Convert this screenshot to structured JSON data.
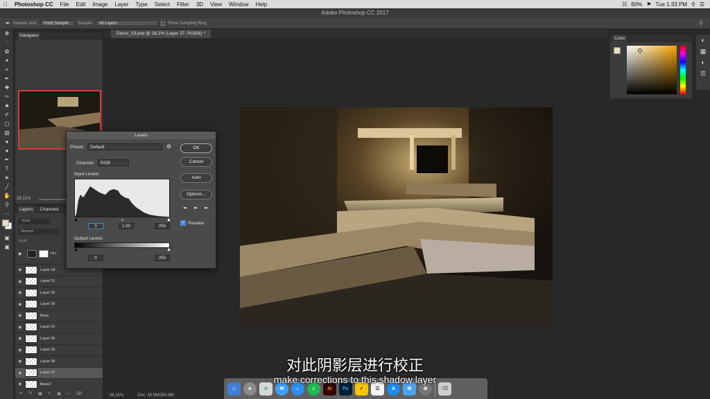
{
  "menubar": {
    "apple": "",
    "items": [
      "Photoshop CC",
      "File",
      "Edit",
      "Image",
      "Layer",
      "Type",
      "Select",
      "Filter",
      "3D",
      "View",
      "Window",
      "Help"
    ],
    "battery": "60%",
    "clock": "Tue 1:33 PM"
  },
  "window": {
    "title": "Adobe Photoshop CC 2017"
  },
  "options": {
    "sample_size_label": "Sample Size:",
    "sample_size_value": "Point Sample",
    "sample_label": "Sample:",
    "sample_value": "All Layers",
    "ring_label": "Show Sampling Ring"
  },
  "document": {
    "tab": "Demo_03.psd @ 28.2% (Layer 37, RGB/8) *"
  },
  "navigator": {
    "title": "Navigator",
    "zoom": "28.21%"
  },
  "layers_panel": {
    "tabs": [
      "Layers",
      "Channels"
    ],
    "kind": "Kind",
    "blend": "Normal",
    "lock_label": "Lock:",
    "rows": [
      "Layer 18",
      "Layer 31",
      "Layer 33",
      "Layer 30",
      "Base",
      "Layer 21",
      "Layer 35",
      "Layer 33",
      "Layer 36",
      "Layer 37",
      "Base2"
    ],
    "selected": "Layer 37",
    "adjustment_label": "Hu..."
  },
  "color_panel": {
    "title": "Color",
    "fg": "#e9dcc0"
  },
  "status": {
    "zoom": "28.21%",
    "doc": "Doc: 16.0M/250.8M"
  },
  "levels": {
    "title": "Levels",
    "preset_label": "Preset:",
    "preset_value": "Default",
    "channel_label": "Channel:",
    "channel_value": "RGB",
    "input_label": "Input Levels:",
    "input_black": "0",
    "input_gamma": "1.00",
    "input_white": "255",
    "output_label": "Output Levels:",
    "output_black": "0",
    "output_white": "255",
    "buttons": {
      "ok": "OK",
      "cancel": "Cancel",
      "auto": "Auto",
      "options": "Options..."
    },
    "preview_label": "Preview",
    "preview_checked": true
  },
  "dock": {
    "items": [
      "finder",
      "launchpad",
      "photos",
      "messages",
      "safari",
      "spotify",
      "Ai",
      "Ps",
      "norton",
      "notes",
      "appstore",
      "mail",
      "system-prefs",
      "trash"
    ]
  },
  "subtitles": {
    "chinese": "对此阴影层进行校正",
    "english": "make corrections to this shadow layer"
  }
}
